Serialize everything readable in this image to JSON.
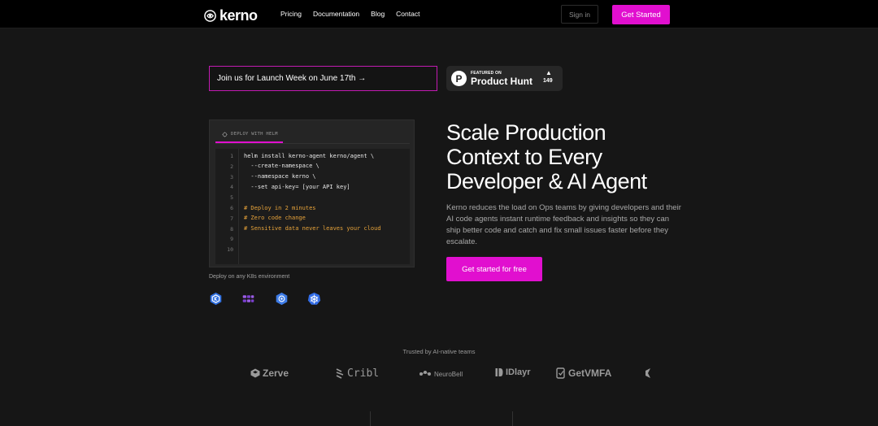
{
  "nav": {
    "brand": "kerno",
    "links": [
      "Pricing",
      "Documentation",
      "Blog",
      "Contact"
    ],
    "signin": "Sign in",
    "cta": "Get Started"
  },
  "banner": {
    "launch_text": "Join us for Launch Week on June 17th →",
    "ph_featured": "FEATURED ON",
    "ph_name": "Product Hunt",
    "ph_votes": "149"
  },
  "code": {
    "tab_label": "DEPLOY WITH HELM",
    "lines": [
      {
        "n": "1",
        "text": "helm install kerno-agent kerno/agent \\",
        "kind": "code"
      },
      {
        "n": "2",
        "text": "  --create-namespace \\",
        "kind": "code"
      },
      {
        "n": "3",
        "text": "  --namespace kerno \\",
        "kind": "code"
      },
      {
        "n": "4",
        "text": "  --set api-key= [your API key]",
        "kind": "code"
      },
      {
        "n": "5",
        "text": "",
        "kind": "code"
      },
      {
        "n": "6",
        "text": "# Deploy in 2 minutes",
        "kind": "comment"
      },
      {
        "n": "7",
        "text": "# Zero code change",
        "kind": "comment"
      },
      {
        "n": "8",
        "text": "# Sensitive data never leaves your cloud",
        "kind": "comment"
      },
      {
        "n": "9",
        "text": "",
        "kind": "code"
      },
      {
        "n": "10",
        "text": "",
        "kind": "code"
      }
    ],
    "deploy_note": "Deploy on any K8s environment"
  },
  "hero": {
    "title_lines": [
      "Scale Production",
      "Context to Every",
      "Developer & AI Agent"
    ],
    "description": "Kerno reduces the load on Ops teams by giving developers and their AI code agents instant runtime feedback and insights so they can ship better code and catch and fix small issues faster before they escalate.",
    "cta": "Get started for free"
  },
  "trusted": {
    "label": "Trusted by AI-native teams",
    "brands": [
      "Zerve",
      "Cribl",
      "NeuroBell",
      "IDlayr",
      "GetVMFA"
    ]
  },
  "colors": {
    "accent": "#e10fcf",
    "background": "#161616",
    "nav_bg": "#000000",
    "comment": "#e7a33a"
  }
}
